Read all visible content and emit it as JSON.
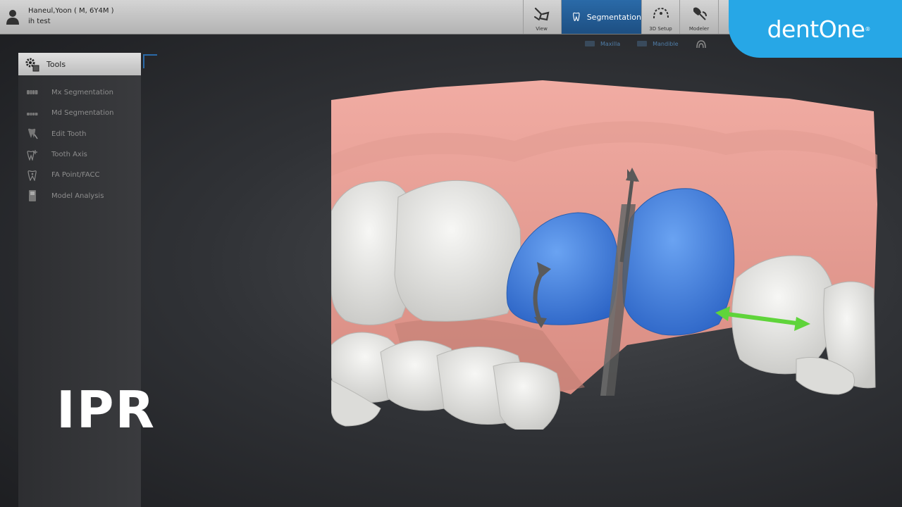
{
  "header": {
    "patient_name": "Haneul,Yoon ( M, 6Y4M )",
    "patient_note": "ih test"
  },
  "nav": {
    "view": "View",
    "segmentation": "Segmentation",
    "setup_3d": "3D Setup",
    "modeler": "Modeler",
    "active": "Segmentation"
  },
  "logo": {
    "text": "dentOne",
    "reg": "®"
  },
  "subbar": {
    "maxilla": "Maxilla",
    "mandible": "Mandible"
  },
  "tools": {
    "title": "Tools",
    "items": [
      {
        "label": "Mx Segmentation",
        "icon": "upper-teeth-icon"
      },
      {
        "label": "Md Segmentation",
        "icon": "lower-teeth-icon"
      },
      {
        "label": "Edit Tooth",
        "icon": "edit-tooth-icon"
      },
      {
        "label": "Tooth Axis",
        "icon": "tooth-axis-icon"
      },
      {
        "label": "FA Point/FACC",
        "icon": "fa-point-icon"
      },
      {
        "label": "Model Analysis",
        "icon": "model-analysis-icon"
      }
    ]
  },
  "overlay": {
    "title": "IPR"
  },
  "colors": {
    "accent": "#27a7e6",
    "nav_active": "#1d4f82",
    "gum": "#e8a59c",
    "selected_tooth": "#4a86e8",
    "tooth": "#e8e8e6",
    "move_arrow": "#5fd43a"
  }
}
